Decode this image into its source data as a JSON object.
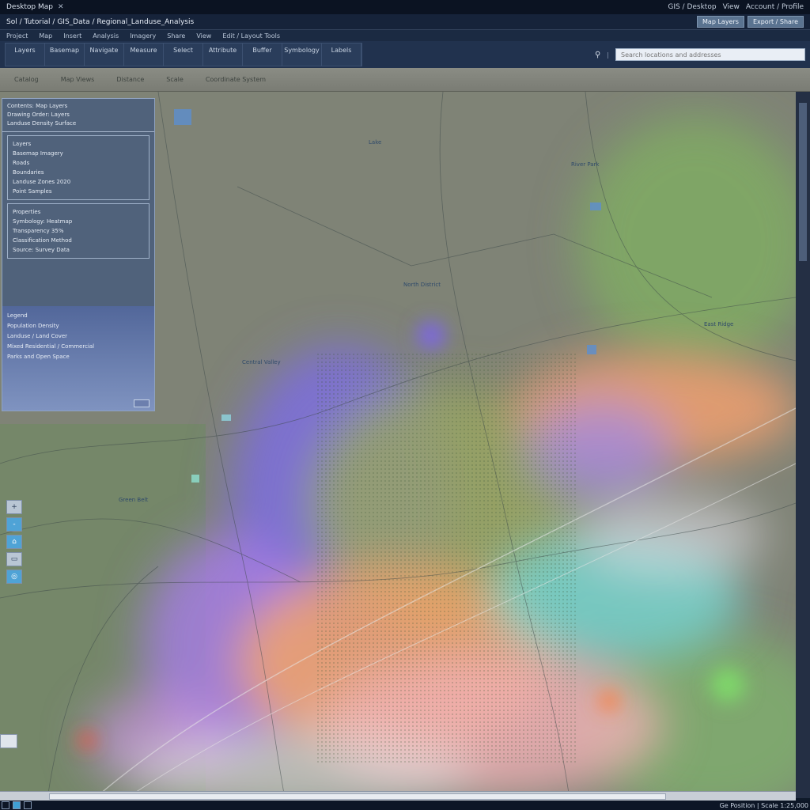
{
  "titlebar": {
    "app": "Desktop Map",
    "right": [
      "GIS / Desktop",
      "View",
      "Account / Profile"
    ]
  },
  "pathbar": {
    "path": "Sol / Tutorial / GIS_Data / Regional_Landuse_Analysis",
    "buttons": [
      "Map Layers",
      "Export / Share"
    ]
  },
  "menubar": {
    "items": [
      "Project",
      "Map",
      "Insert",
      "Analysis",
      "Imagery",
      "Share",
      "View",
      "Edit / Layout Tools"
    ]
  },
  "toolbar": {
    "tools": [
      "Layers",
      "Basemap",
      "Navigate",
      "Measure",
      "Select",
      "Attribute",
      "Buffer",
      "Symbology",
      "Labels"
    ],
    "search_placeholder": "Search locations and addresses"
  },
  "ribbon": {
    "items": [
      "Catalog",
      "Map Views",
      "Distance",
      "Scale",
      "Coordinate System"
    ]
  },
  "panel": {
    "header": [
      "Contents: Map Layers",
      "Drawing Order: Layers",
      "Landuse Density Surface"
    ],
    "section1": [
      "Layers",
      "Basemap Imagery",
      "Roads",
      "Boundaries",
      "Landuse Zones 2020",
      "Point Samples"
    ],
    "section2": [
      "Properties",
      "Symbology: Heatmap",
      "Transparency 35%",
      "Classification Method",
      "Source: Survey Data"
    ],
    "footer_label": "Legend",
    "footer": [
      "Population Density",
      "Landuse / Land Cover",
      "Mixed Residential / Commercial",
      "Parks and Open Space"
    ]
  },
  "side_tools": [
    "+",
    "-",
    "⌂",
    "▭",
    "◎"
  ],
  "map_labels": [
    "Lake",
    "River Park",
    "North District",
    "Central Valley",
    "East Ridge",
    "Green Belt"
  ],
  "status": {
    "coords": "Ge Position | Scale 1:25,000"
  },
  "colors": {
    "purple": "#8a7ad8",
    "orange": "#f0a060",
    "cyan": "#6fd8d0",
    "green": "#7fb86a",
    "pink": "#f2a2a8"
  }
}
